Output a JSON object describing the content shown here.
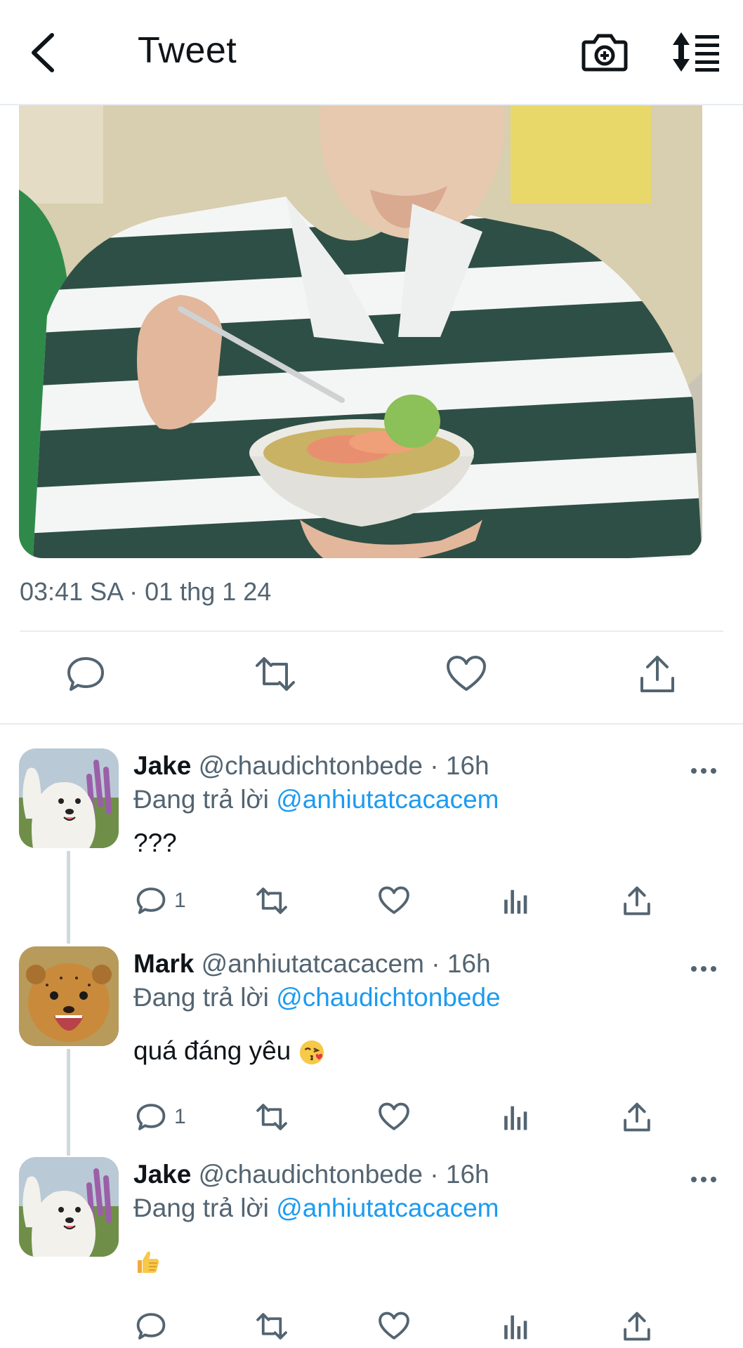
{
  "header": {
    "title": "Tweet",
    "back_icon": "chevron-left-icon",
    "camera_icon": "camera-add-icon",
    "sort_icon": "sort-icon"
  },
  "tweet": {
    "timestamp": "03:41 SA · 01 thg 1 24",
    "actions": [
      "reply-icon",
      "retweet-icon",
      "like-icon",
      "share-icon"
    ]
  },
  "replies": [
    {
      "name": "Jake",
      "handle": "@chaudichtonbede",
      "time": "· 16h",
      "replying_label": "Đang trả lời",
      "replying_to": "@anhiutatcacacem",
      "text": "???",
      "reply_count": "1",
      "avatar": "samoyed-dog-avatar"
    },
    {
      "name": "Mark",
      "handle": "@anhiutatcacacem",
      "time": "· 16h",
      "replying_label": "Đang trả lời",
      "replying_to": "@chaudichtonbede",
      "text": "quá đáng yêu",
      "emoji": "kissing-face-emoji",
      "reply_count": "1",
      "avatar": "cheetah-cub-avatar"
    },
    {
      "name": "Jake",
      "handle": "@chaudichtonbede",
      "time": "· 16h",
      "replying_label": "Đang trả lời",
      "replying_to": "@anhiutatcacacem",
      "text": "",
      "emoji": "thumbs-up-emoji",
      "reply_count": "",
      "avatar": "samoyed-dog-avatar"
    }
  ],
  "colors": {
    "link": "#1d9bf0",
    "secondary_text": "#536471",
    "divider": "#e6ecf0"
  }
}
